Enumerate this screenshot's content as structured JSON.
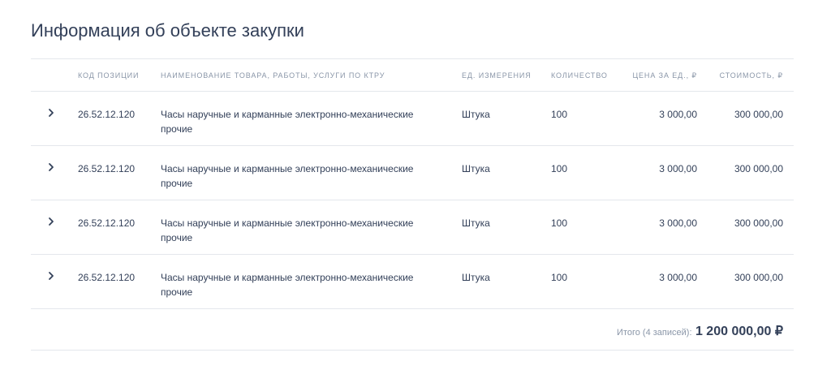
{
  "page": {
    "title": "Информация об объекте закупки"
  },
  "table": {
    "columns": {
      "code": "Код позиции",
      "name": "Наименование товара, работы, услуги по КТРУ",
      "unit": "Ед. измерения",
      "qty": "Количество",
      "price": "Цена за ед., ₽",
      "cost": "Стоимость, ₽"
    },
    "rows": [
      {
        "code": "26.52.12.120",
        "name": "Часы наручные и карманные электронно-механические прочие",
        "unit": "Штука",
        "qty": "100",
        "price": "3 000,00",
        "cost": "300 000,00"
      },
      {
        "code": "26.52.12.120",
        "name": "Часы наручные и карманные электронно-механические прочие",
        "unit": "Штука",
        "qty": "100",
        "price": "3 000,00",
        "cost": "300 000,00"
      },
      {
        "code": "26.52.12.120",
        "name": "Часы наручные и карманные электронно-механические прочие",
        "unit": "Штука",
        "qty": "100",
        "price": "3 000,00",
        "cost": "300 000,00"
      },
      {
        "code": "26.52.12.120",
        "name": "Часы наручные и карманные электронно-механические прочие",
        "unit": "Штука",
        "qty": "100",
        "price": "3 000,00",
        "cost": "300 000,00"
      }
    ],
    "icons": {
      "expand": "chevron-right-icon"
    }
  },
  "total": {
    "label": "Итого (4 записей):",
    "value": "1 200 000,00 ₽"
  }
}
